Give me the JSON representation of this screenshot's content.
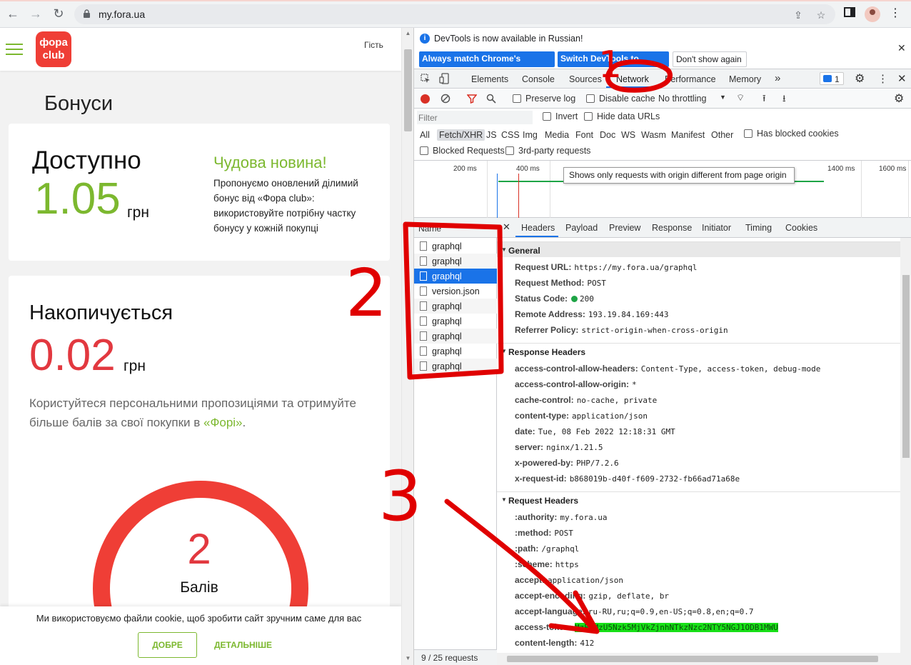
{
  "browser": {
    "url": "my.fora.ua"
  },
  "site": {
    "logo_line1": "фора",
    "logo_line2": "club",
    "guest_label": "Гість",
    "page_title": "Бонуси",
    "available": {
      "label": "Доступно",
      "value": "1.05",
      "unit": "грн",
      "news_title": "Чудова новина!",
      "news_text": "Пропонуємо оновлений ділимий бонус від «Фора club»: використовуйте потрібну частку бонусу у кожній покупці"
    },
    "accumulating": {
      "label": "Накопичується",
      "value": "0.02",
      "unit": "грн",
      "text": "Користуйтеся персональними пропозиціями та отримуйте більше балів за свої покупки в ",
      "link": "«Форі»",
      "text_end": ".",
      "points_value": "2",
      "points_label": "Балів"
    },
    "cookie": {
      "text": "Ми використовуємо файли cookie, щоб зробити сайт зручним саме для вас",
      "ok": "ДОБРЕ",
      "more": "ДЕТАЛЬНІШЕ"
    }
  },
  "devtools": {
    "infobar": {
      "text": "DevTools is now available in Russian!",
      "btn1": "Always match Chrome's language",
      "btn2": "Switch DevTools to Russian",
      "btn3": "Don't show again"
    },
    "tabs": [
      "Elements",
      "Console",
      "Sources",
      "Network",
      "Performance",
      "Memory"
    ],
    "more_tabs": "»",
    "issues_count": "1",
    "toolbar": {
      "preserve_log": "Preserve log",
      "disable_cache": "Disable cache",
      "throttling": "No throttling"
    },
    "filter": {
      "placeholder": "Filter",
      "invert": "Invert",
      "hide_data_urls": "Hide data URLs",
      "types": [
        "All",
        "Fetch/XHR",
        "JS",
        "CSS",
        "Img",
        "Media",
        "Font",
        "Doc",
        "WS",
        "Wasm",
        "Manifest",
        "Other"
      ],
      "has_blocked_cookies": "Has blocked cookies",
      "blocked_requests": "Blocked Requests",
      "third_party": "3rd-party requests"
    },
    "timeline": {
      "ticks": [
        "200 ms",
        "400 ms",
        "1400 ms",
        "1600 ms"
      ],
      "tooltip": "Shows only requests with origin different from page origin"
    },
    "requests": {
      "header": "Name",
      "items": [
        "graphql",
        "graphql",
        "graphql",
        "version.json",
        "graphql",
        "graphql",
        "graphql",
        "graphql",
        "graphql"
      ],
      "status": "9 / 25 requests"
    },
    "details": {
      "tabs": [
        "Headers",
        "Payload",
        "Preview",
        "Response",
        "Initiator",
        "Timing",
        "Cookies"
      ],
      "general_title": "General",
      "general": [
        {
          "k": "Request URL:",
          "v": "https://my.fora.ua/graphql"
        },
        {
          "k": "Request Method:",
          "v": "POST"
        },
        {
          "k": "Status Code:",
          "v": "200"
        },
        {
          "k": "Remote Address:",
          "v": "193.19.84.169:443"
        },
        {
          "k": "Referrer Policy:",
          "v": "strict-origin-when-cross-origin"
        }
      ],
      "response_title": "Response Headers",
      "response": [
        {
          "k": "access-control-allow-headers:",
          "v": "Content-Type, access-token, debug-mode"
        },
        {
          "k": "access-control-allow-origin:",
          "v": "*"
        },
        {
          "k": "cache-control:",
          "v": "no-cache, private"
        },
        {
          "k": "content-type:",
          "v": "application/json"
        },
        {
          "k": "date:",
          "v": "Tue, 08 Feb 2022 12:18:31 GMT"
        },
        {
          "k": "server:",
          "v": "nginx/1.21.5"
        },
        {
          "k": "x-powered-by:",
          "v": "PHP/7.2.6"
        },
        {
          "k": "x-request-id:",
          "v": "b868019b-d40f-f609-2732-fb66ad71a68e"
        }
      ],
      "request_title": "Request Headers",
      "request": [
        {
          "k": ":authority:",
          "v": "my.fora.ua"
        },
        {
          "k": ":method:",
          "v": "POST"
        },
        {
          "k": ":path:",
          "v": "/graphql"
        },
        {
          "k": ":scheme:",
          "v": "https"
        },
        {
          "k": "accept:",
          "v": "application/json"
        },
        {
          "k": "accept-encoding:",
          "v": "gzip, deflate, br"
        },
        {
          "k": "accept-language:",
          "v": "ru-RU,ru;q=0.9,en-US;q=0.8,en;q=0.7"
        },
        {
          "k": "access-token:",
          "v": "MzEwMzU5Nzk5MjVkZjnhNTkzNzc2NTY5NGJ1ODB1MWU"
        },
        {
          "k": "content-length:",
          "v": "412"
        }
      ]
    }
  },
  "annotations": {
    "label1": "1",
    "label2": "2",
    "label3": "3",
    "color": "#e00000"
  }
}
